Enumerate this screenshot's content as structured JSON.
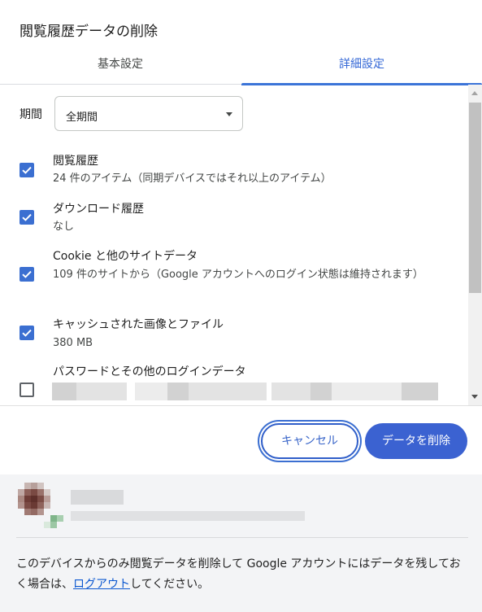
{
  "dialog": {
    "title": "閲覧履歴データの削除"
  },
  "tabs": [
    {
      "label": "基本設定",
      "selected": false
    },
    {
      "label": "詳細設定",
      "selected": true
    }
  ],
  "period": {
    "label": "期間",
    "value": "全期間"
  },
  "items": [
    {
      "title": "閲覧履歴",
      "desc": "24 件のアイテム（同期デバイスではそれ以上のアイテム）",
      "checked": true
    },
    {
      "title": "ダウンロード履歴",
      "desc": "なし",
      "checked": true
    },
    {
      "title": "Cookie と他のサイトデータ",
      "desc": "109 件のサイトから（Google アカウントへのログイン状態は維持されます）",
      "checked": true
    },
    {
      "title": "キャッシュされた画像とファイル",
      "desc": "380 MB",
      "checked": true
    },
    {
      "title": "パスワードとその他のログインデータ",
      "desc": "",
      "checked": false
    }
  ],
  "buttons": {
    "cancel": "キャンセル",
    "delete": "データを削除"
  },
  "account": {
    "note_before": "このデバイスからのみ閲覧データを削除して Google アカウントにはデータを残しておく場合は、",
    "logout_link": "ログアウト",
    "note_after": "してください。"
  },
  "colors": {
    "accent": "#3b62d1",
    "tab_active": "#3367d6",
    "checkbox": "#3b6fd1"
  },
  "icons": {
    "dropdown": "chevron-down-icon",
    "check": "check-icon"
  }
}
